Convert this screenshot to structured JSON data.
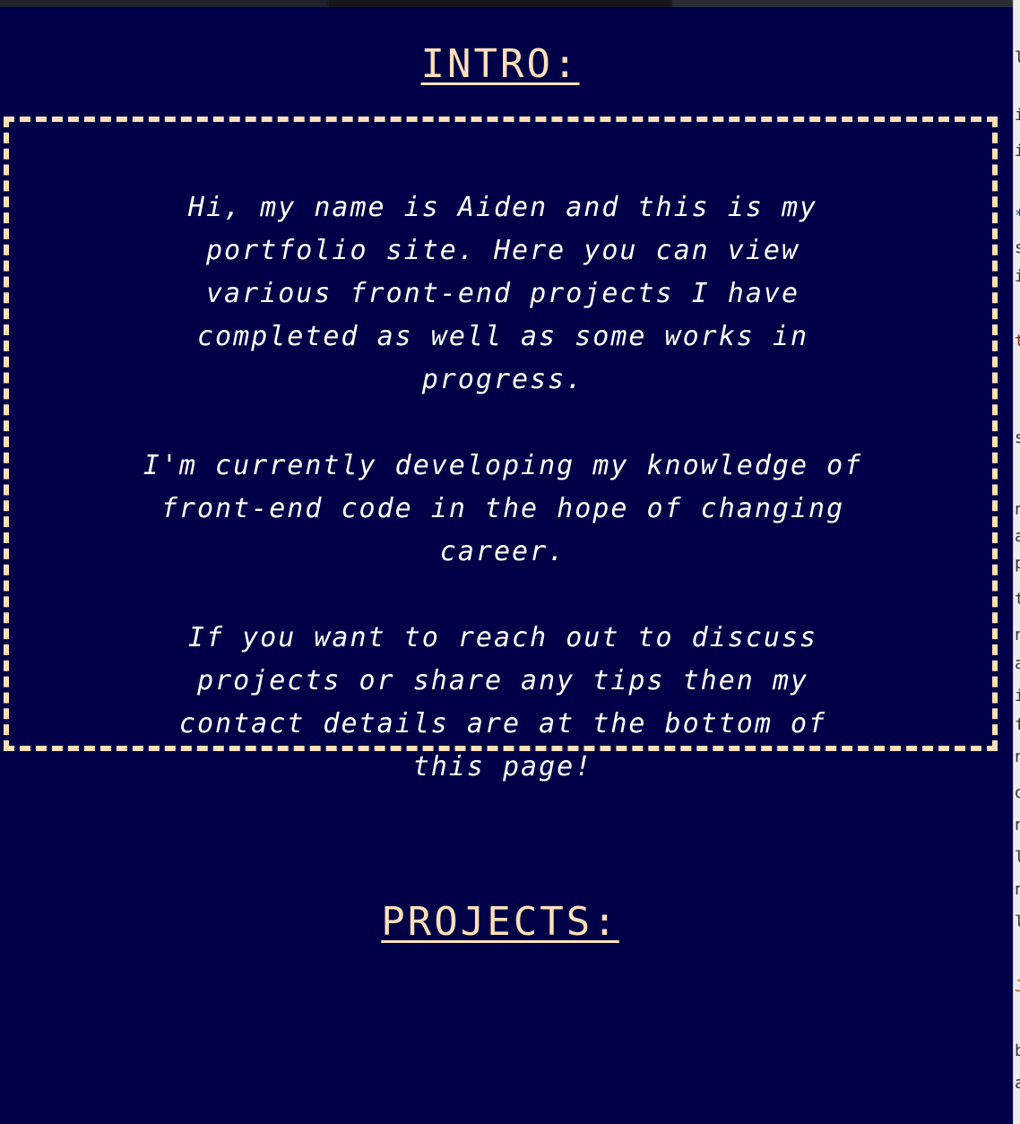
{
  "intro": {
    "heading": "INTRO:",
    "paragraphs": [
      "Hi, my name is Aiden and this is my portfolio site. Here you can view various front-end projects I have completed as well as some works in progress.",
      "I'm currently developing my knowledge of front-end code in the hope of changing career.",
      "If you want to reach out to discuss projects or share any tips then my contact details are at the bottom of this page!"
    ]
  },
  "projects": {
    "heading": "PROJECTS:"
  },
  "colors": {
    "background": "#000048",
    "accent": "#fde0b8",
    "text": "#ffffff"
  }
}
